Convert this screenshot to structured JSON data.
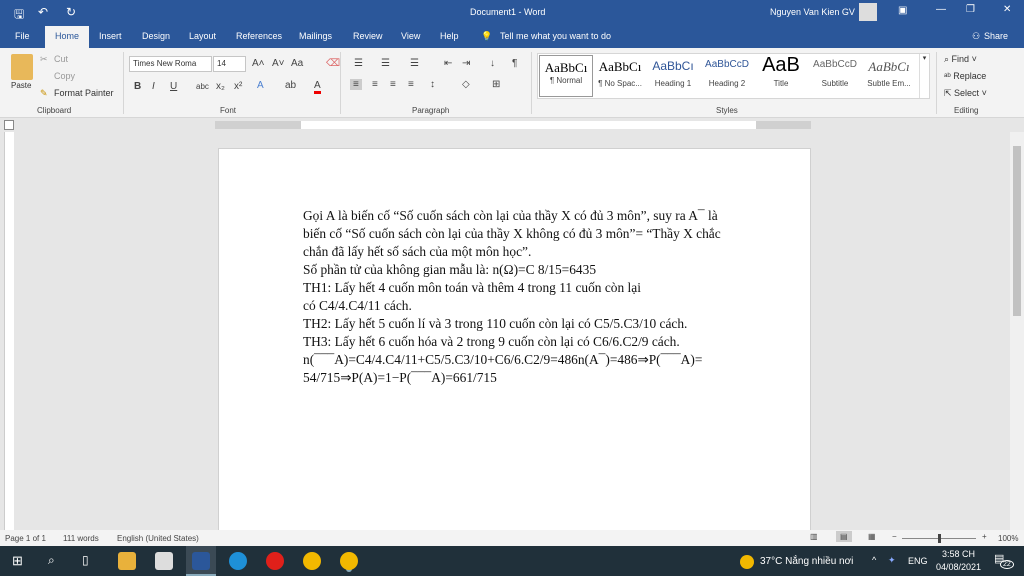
{
  "window": {
    "title": "Document1 - Word",
    "user": "Nguyen Van Kien GV"
  },
  "tabs": [
    "File",
    "Home",
    "Insert",
    "Design",
    "Layout",
    "References",
    "Mailings",
    "Review",
    "View",
    "Help"
  ],
  "tell_me": "Tell me what you want to do",
  "share": "Share",
  "clipboard": {
    "paste": "Paste",
    "cut": "Cut",
    "copy": "Copy",
    "format_painter": "Format Painter",
    "label": "Clipboard"
  },
  "font": {
    "name": "Times New Roma",
    "size": "14",
    "label": "Font"
  },
  "paragraph": {
    "label": "Paragraph"
  },
  "styles": {
    "items": [
      {
        "preview": "AaBbCı",
        "name": "¶ Normal"
      },
      {
        "preview": "AaBbCı",
        "name": "¶ No Spac..."
      },
      {
        "preview": "AaBbCı",
        "name": "Heading 1"
      },
      {
        "preview": "AaBbCcD",
        "name": "Heading 2"
      },
      {
        "preview": "AaB",
        "name": "Title"
      },
      {
        "preview": "AaBbCcD",
        "name": "Subtitle"
      },
      {
        "preview": "AaBbCı",
        "name": "Subtle Em..."
      }
    ],
    "label": "Styles"
  },
  "editing": {
    "find": "Find",
    "replace": "Replace",
    "select": "Select",
    "label": "Editing"
  },
  "document": {
    "lines": [
      "Gọi A là biến cố “Số cuốn sách còn lại của thầy X có đủ 3 môn”, suy ra A¯ là",
      "biến cố “Số cuốn sách còn lại của thầy X không có đủ 3 môn”= “Thầy X chắc",
      "chắn đã lấy hết số sách của một môn học”.",
      "Số phần tử của không gian mẫu là: n(Ω)=C 8/15=6435",
      "TH1: Lấy hết 4 cuốn môn toán và thêm 4 trong 11 cuốn còn lại",
      "có C4/4.C4/11 cách.",
      "TH2: Lấy hết 5 cuốn lí và 3 trong 110 cuốn còn lại có C5/5.C3/10 cách.",
      "TH3: Lấy hết 6 cuốn hóa và 2 trong 9 cuốn còn lại có C6/6.C2/9 cách.",
      "n(¯¯¯A)=C4/4.C4/11+C5/5.C3/10+C6/6.C2/9=486n(A¯)=486⇒P(¯¯¯A)=",
      "54/715⇒P(A)=1−P(¯¯¯A)=661/715"
    ]
  },
  "status": {
    "page": "Page 1 of 1",
    "words": "111 words",
    "language": "English (United States)",
    "zoom": "100%"
  },
  "taskbar": {
    "weather": "37°C  Nắng nhiều nơi",
    "lang": "ENG",
    "time": "3:58 CH",
    "date": "04/08/2021",
    "notifications": "22"
  }
}
